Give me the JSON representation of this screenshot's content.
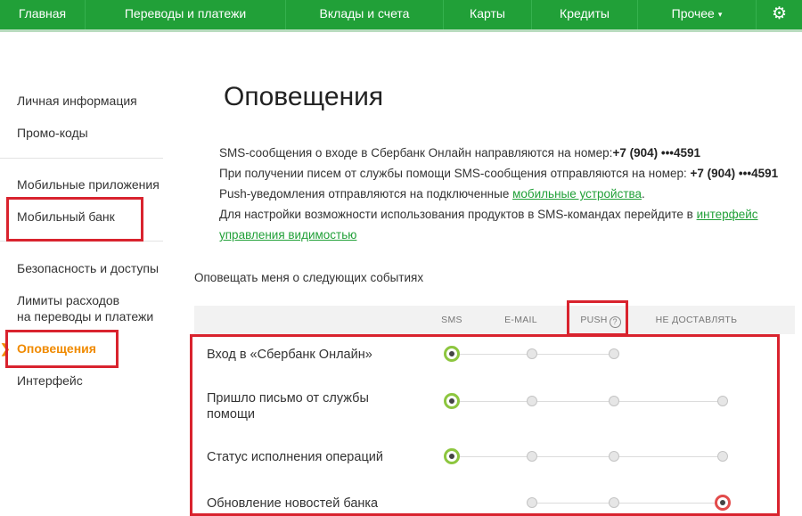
{
  "nav": {
    "items": [
      {
        "label": "Главная"
      },
      {
        "label": "Переводы и платежи"
      },
      {
        "label": "Вклады и счета"
      },
      {
        "label": "Карты"
      },
      {
        "label": "Кредиты"
      },
      {
        "label": "Прочее",
        "caret": "▾"
      }
    ],
    "settings_icon": "gear-icon",
    "settings_glyph": "⚙"
  },
  "sidebar": {
    "items": [
      {
        "label": "Личная информация"
      },
      {
        "label": "Промо-коды"
      },
      {
        "label": "Мобильные приложения"
      },
      {
        "label": "Мобильный банк"
      },
      {
        "label": "Безопасность и доступы"
      },
      {
        "label": "Лимиты расходов"
      },
      {
        "label": "на переводы и платежи"
      },
      {
        "label": "Оповещения",
        "active": true
      },
      {
        "label": "Интерфейс"
      }
    ],
    "active_marker": "❯"
  },
  "main": {
    "title": "Оповещения",
    "info": {
      "line1_text": "SMS-сообщения о входе в Сбербанк Онлайн направляются на номер:",
      "line1_phone": "+7 (904) •••4591",
      "line2_text": "При получении писем от службы помощи SMS-сообщения отправляются на номер: ",
      "line2_phone": "+7 (904) •••4591",
      "line3_text": "Push-уведомления отправляются на подключенные ",
      "line3_link": "мобильные устройства",
      "line3_end": ".",
      "line4_text": "Для настройки возможности использования продуктов в SMS-командах перейдите в ",
      "line4_link_a": "интерфейс",
      "line4_link_b": "управления видимостью"
    },
    "events_label": "Оповещать меня о следующих событиях",
    "columns": {
      "sms": "SMS",
      "email": "E-MAIL",
      "push": "PUSH",
      "push_help": "?",
      "none": "НЕ ДОСТАВЛЯТЬ"
    },
    "rows": [
      {
        "label_1": "Вход в «Сбербанк Онлайн»",
        "label_2": "",
        "selected": "sms"
      },
      {
        "label_1": "Пришло письмо от службы",
        "label_2": "помощи",
        "selected": "sms"
      },
      {
        "label_1": "Статус исполнения операций",
        "label_2": "",
        "selected": "sms"
      },
      {
        "label_1": "Обновление новостей банка",
        "label_2": "",
        "selected": "none"
      }
    ]
  },
  "colors": {
    "brand_green": "#21a038",
    "active_orange": "#f08a00",
    "highlight_red": "#d9232e"
  }
}
